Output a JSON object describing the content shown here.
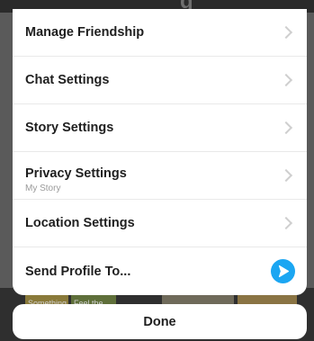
{
  "sheet": {
    "items": [
      {
        "label": "Manage Friendship",
        "sublabel": "",
        "trailing": "chevron"
      },
      {
        "label": "Chat Settings",
        "sublabel": "",
        "trailing": "chevron"
      },
      {
        "label": "Story Settings",
        "sublabel": "",
        "trailing": "chevron"
      },
      {
        "label": "Privacy Settings",
        "sublabel": "My Story",
        "trailing": "chevron"
      },
      {
        "label": "Location Settings",
        "sublabel": "",
        "trailing": "chevron"
      },
      {
        "label": "Send Profile To...",
        "sublabel": "",
        "trailing": "send-arrow-icon"
      }
    ]
  },
  "done_label": "Done",
  "backdrop": {
    "thumb_labels": [
      "Something",
      "Feel the"
    ]
  },
  "colors": {
    "accent": "#1ba6f2",
    "sheet_bg": "#ffffff",
    "backdrop": "#3c3c3c"
  }
}
